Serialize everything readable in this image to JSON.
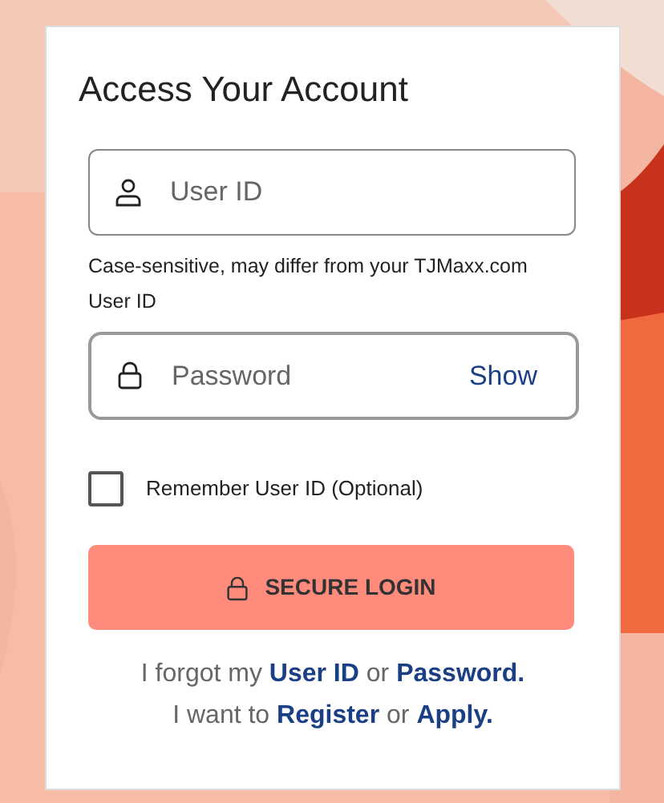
{
  "title": "Access Your Account",
  "user_field": {
    "placeholder": "User ID"
  },
  "user_hint": "Case-sensitive, may differ from your TJMaxx.com User ID",
  "password_field": {
    "placeholder": "Password",
    "toggle": "Show"
  },
  "remember": {
    "label": "Remember User ID (Optional)",
    "checked": false
  },
  "login_button": "SECURE LOGIN",
  "help_lines": [
    [
      {
        "text": "I forgot my",
        "link": false
      },
      {
        "text": "User ID",
        "link": true
      },
      {
        "text": "or",
        "link": false
      },
      {
        "text": "Password.",
        "link": true
      }
    ],
    [
      {
        "text": "I want to",
        "link": false
      },
      {
        "text": "Register",
        "link": true
      },
      {
        "text": "or",
        "link": false
      },
      {
        "text": "Apply.",
        "link": true
      }
    ]
  ]
}
